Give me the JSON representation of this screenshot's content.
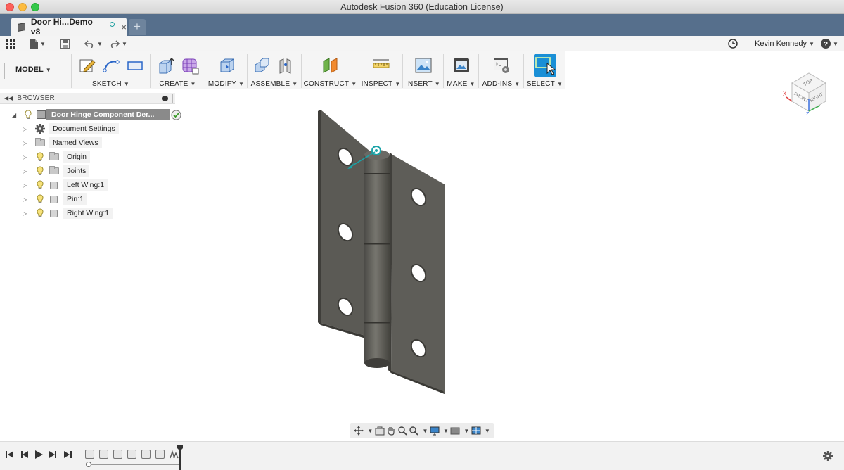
{
  "window": {
    "title": "Autodesk Fusion 360 (Education License)"
  },
  "tab": {
    "label": "Door Hi...Demo v8",
    "new_tab": "+",
    "close": "×"
  },
  "quick_access": {
    "user": "Kevin Kennedy",
    "help": "?"
  },
  "toolbar": {
    "workspace": "MODEL",
    "groups": [
      {
        "label": "SKETCH"
      },
      {
        "label": "CREATE"
      },
      {
        "label": "MODIFY"
      },
      {
        "label": "ASSEMBLE"
      },
      {
        "label": "CONSTRUCT"
      },
      {
        "label": "INSPECT"
      },
      {
        "label": "INSERT"
      },
      {
        "label": "MAKE"
      },
      {
        "label": "ADD-INS"
      },
      {
        "label": "SELECT"
      }
    ]
  },
  "browser": {
    "title": "BROWSER",
    "root": "Door Hinge Component Der...",
    "items": [
      {
        "label": "Document Settings",
        "icon": "gear-icon"
      },
      {
        "label": "Named Views",
        "icon": "folder-icon"
      },
      {
        "label": "Origin",
        "icon": "folder-icon"
      },
      {
        "label": "Joints",
        "icon": "folder-icon"
      },
      {
        "label": "Left Wing:1",
        "icon": "body-icon"
      },
      {
        "label": "Pin:1",
        "icon": "body-icon"
      },
      {
        "label": "Right Wing:1",
        "icon": "body-icon"
      }
    ]
  },
  "viewcube": {
    "top": "TOP",
    "front": "FRONT",
    "right": "RIGHT",
    "x": "X",
    "z": "Z"
  },
  "colors": {
    "tabbar": "#566f8c",
    "accent": "#1a8fd6",
    "model": "#5b5a55"
  }
}
